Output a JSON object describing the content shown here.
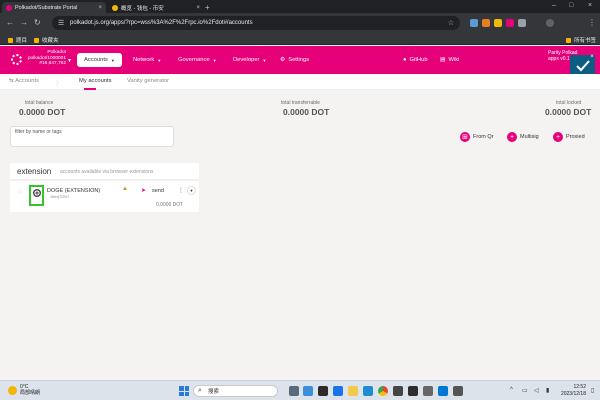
{
  "browser": {
    "tabs": [
      {
        "title": "Polkadot/Substrate Portal",
        "active": true
      },
      {
        "title": "概览 - 钱包 - 币安",
        "active": false
      }
    ],
    "url": "polkadot.js.org/apps/?rpc=wss%3A%2F%2Frpc.io%2Fdot#/accounts",
    "bookmarks": [
      "题目",
      "收藏夹"
    ],
    "all_bookmarks": "所有书签"
  },
  "header": {
    "chain_name": "Polkadot",
    "chain_version": "polkadot/1000001",
    "block_number": "#18,647,782",
    "nav": [
      {
        "label": "Accounts",
        "active": true
      },
      {
        "label": "Network"
      },
      {
        "label": "Governance"
      },
      {
        "label": "Developer"
      },
      {
        "label": "Settings"
      },
      {
        "label": "GitHub"
      },
      {
        "label": "Wiki"
      }
    ],
    "right_line1": "Parity Polkad",
    "right_line2": "apps v0.1"
  },
  "subnav": {
    "section": "Accounts",
    "tabs": [
      "My accounts",
      "Vanity generator"
    ]
  },
  "summary": {
    "total_balance_label": "total balance",
    "total_balance_value": "0.0000 DOT",
    "transferrable_label": "total transferrable",
    "transferrable_value": "0.0000 DOT",
    "locked_label": "total locked",
    "locked_value": "0.0000 DOT"
  },
  "filter": {
    "label": "filter by name or tags"
  },
  "actions": [
    "From Qr",
    "Multisig",
    "Proxied"
  ],
  "extension": {
    "title": "extension",
    "subtitle": "accounts available via browser extensions",
    "account": {
      "name": "DOGE (EXTENSION)",
      "address": "1fmxj7GNT",
      "send": "send",
      "balance": "0.0000 DOT"
    }
  },
  "taskbar": {
    "weather_temp": "0°C",
    "weather_desc": "局部晴朗",
    "search_placeholder": "搜索",
    "time": "12:52",
    "date": "2023/12/18"
  },
  "colors": {
    "brand": "#e6007a",
    "highlight": "#31c42c",
    "check": "#0d5d83"
  }
}
